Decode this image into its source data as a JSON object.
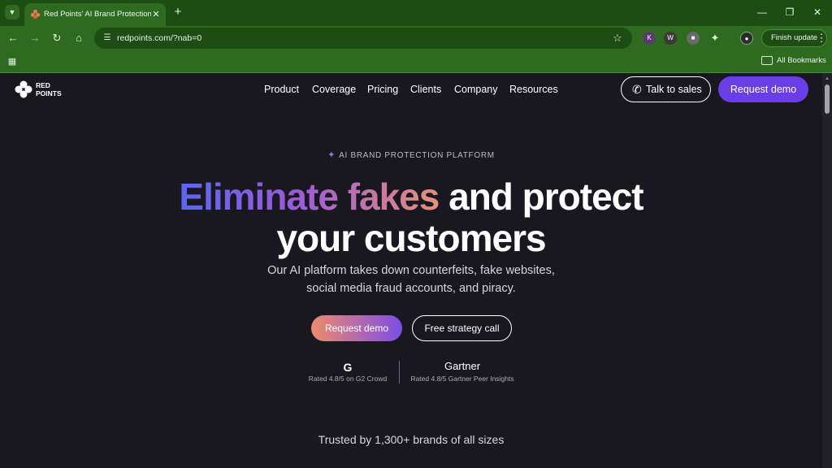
{
  "browser": {
    "tab_title": "Red Points' AI Brand Protection",
    "url": "redpoints.com/?nab=0",
    "finish_update_label": "Finish update",
    "bookmarks_label": "All Bookmarks"
  },
  "nav": {
    "logo_text_line1": "RED",
    "logo_text_line2": "POINTS",
    "links": [
      "Product",
      "Coverage",
      "Pricing",
      "Clients",
      "Company",
      "Resources"
    ],
    "talk_to_sales_label": "Talk to sales",
    "request_demo_label": "Request demo"
  },
  "hero": {
    "eyebrow": "AI BRAND PROTECTION PLATFORM",
    "headline_gradient": "Eliminate fakes",
    "headline_rest_line1": " and protect",
    "headline_line2": "your customers",
    "subtitle_line1": "Our AI platform takes down counterfeits, fake websites,",
    "subtitle_line2": "social media fraud accounts, and piracy.",
    "primary_cta_label": "Request demo",
    "secondary_cta_label": "Free strategy call"
  },
  "ratings": {
    "g2_logo": "G",
    "g2_text": "Rated 4.8/5 on G2 Crowd",
    "gartner_logo": "Gartner",
    "gartner_text": "Rated 4.8/5 Gartner Peer Insights"
  },
  "trusted_text": "Trusted by 1,300+ brands of all sizes",
  "colors": {
    "accent_purple": "#6a3ee6",
    "gradient_start": "#5b67f0",
    "gradient_end": "#e88f7a",
    "page_background": "#191821",
    "browser_frame": "#2e6b20"
  }
}
